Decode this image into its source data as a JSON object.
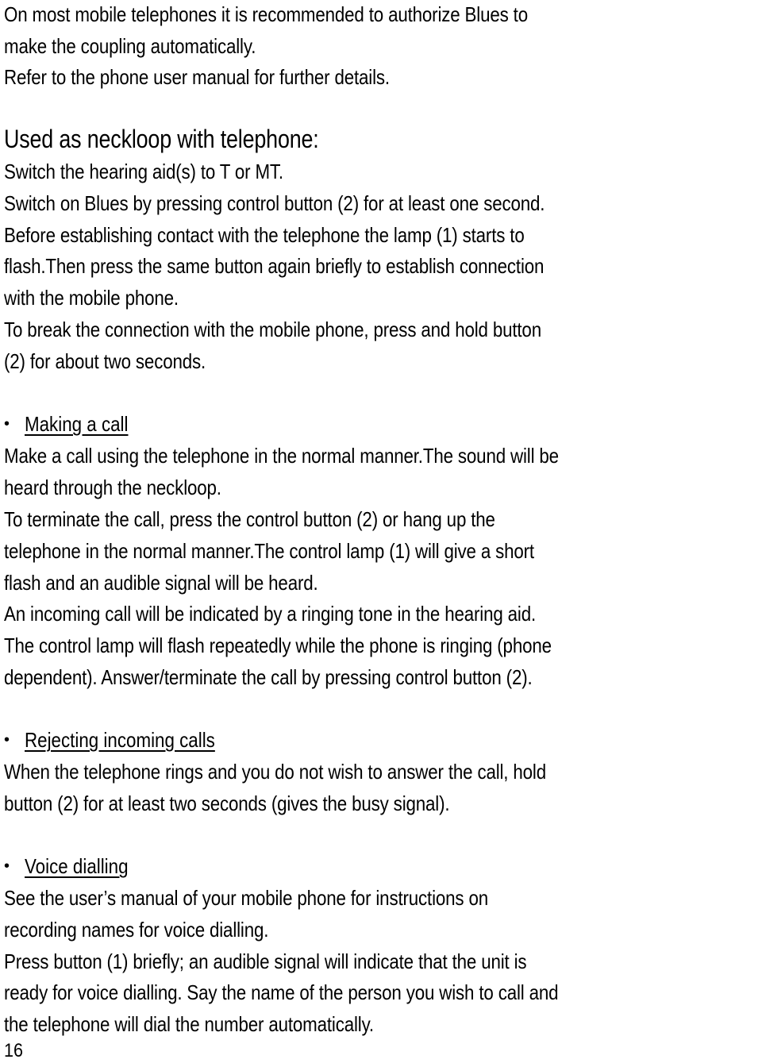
{
  "intro": {
    "lines": [
      "On most mobile telephones it is recommended to authorize Blues to",
      "make the coupling automatically.",
      "Refer to the phone user manual for further details."
    ]
  },
  "neckloop_section": {
    "heading": "Used as neckloop with telephone:",
    "lines": [
      "Switch the hearing aid(s) to T or MT.",
      "Switch on Blues by pressing control button (2) for at least one second.",
      "Before establishing contact with the telephone the lamp (1) starts to",
      "flash.Then press the same button again briefly to establish connection",
      "with the mobile phone.",
      "To break the connection with the mobile phone, press and hold button",
      "(2) for about two seconds."
    ]
  },
  "making_a_call": {
    "bullet": "•",
    "title": "Making a call",
    "lines": [
      "Make a call using the telephone in the normal manner.The sound will be",
      "heard through the neckloop.",
      "To terminate the call, press the control button (2) or hang up the",
      "telephone in the normal manner.The control lamp (1) will give a short",
      "flash and an audible signal will be heard.",
      "An incoming call will be indicated by a ringing tone in the hearing aid.",
      "The control lamp will flash repeatedly while the phone is ringing (phone",
      "dependent). Answer/terminate the call by pressing control button (2)."
    ]
  },
  "rejecting_calls": {
    "bullet": "•",
    "title": "Rejecting incoming calls",
    "lines": [
      "When the telephone rings and you do not wish to answer the call, hold",
      "button (2) for at least two seconds (gives the busy signal)."
    ]
  },
  "voice_dialling": {
    "bullet": "•",
    "title": "Voice dialling",
    "lines": [
      "See the user’s manual of your mobile phone for instructions on",
      "recording names for voice dialling.",
      "Press button (1) briefly; an audible signal will indicate that the unit is",
      "ready for voice dialling. Say the name of the person you wish to call and",
      "the telephone will dial the number automatically."
    ]
  },
  "footer": {
    "page_number": "16"
  }
}
